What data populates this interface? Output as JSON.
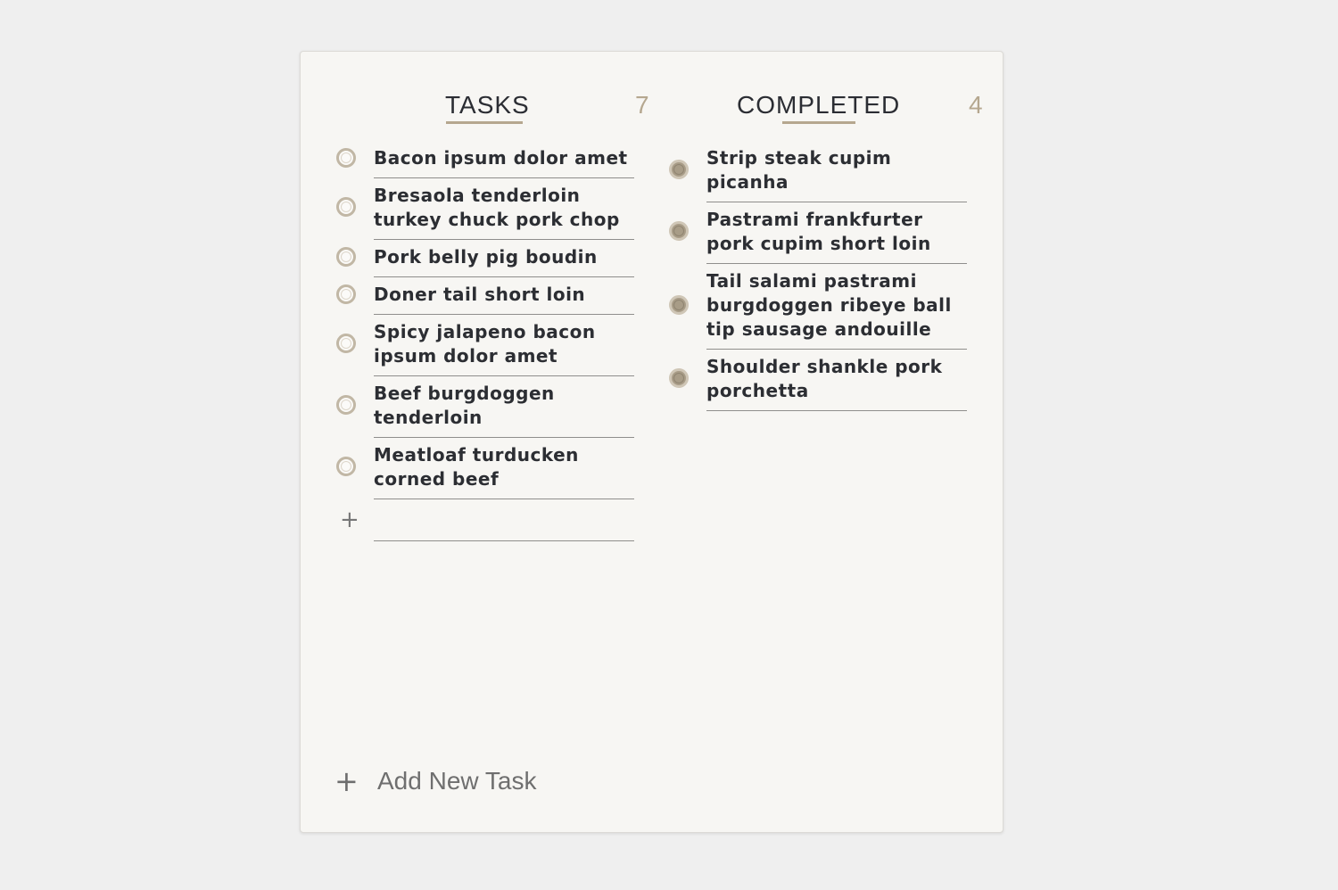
{
  "tasks": {
    "title": "TASKS",
    "count": "7",
    "items": [
      {
        "label": "Bacon ipsum dolor amet"
      },
      {
        "label": "Bresaola tenderloin turkey chuck pork chop"
      },
      {
        "label": "Pork belly pig boudin"
      },
      {
        "label": "Doner tail short loin"
      },
      {
        "label": "Spicy jalapeno bacon ipsum dolor amet"
      },
      {
        "label": "Beef burgdoggen tenderloin"
      },
      {
        "label": "Meatloaf turducken corned beef"
      }
    ]
  },
  "completed": {
    "title": "COMPLETED",
    "count": "4",
    "items": [
      {
        "label": "Strip steak cupim picanha"
      },
      {
        "label": "Pastrami frankfurter pork cupim short loin"
      },
      {
        "label": "Tail salami pastrami burgdoggen ribeye ball tip sausage andouille"
      },
      {
        "label": "Shoulder shankle pork porchetta"
      }
    ]
  },
  "add_new": {
    "label": "Add New Task",
    "icon": "plus-icon"
  },
  "colors": {
    "accent": "#b5a78f",
    "text": "#2c2e33",
    "background": "#efefef",
    "card": "#f7f6f3"
  }
}
